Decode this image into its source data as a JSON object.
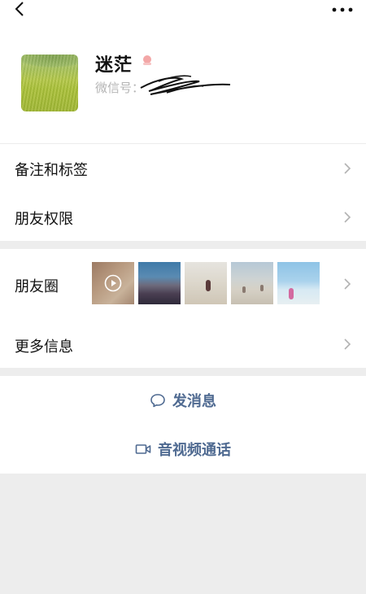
{
  "profile": {
    "nickname": "迷茫",
    "wechat_id_label": "微信号："
  },
  "icons": {
    "back": "chevron-left-icon",
    "more": "more-dots-icon",
    "gender": "female-gender-icon",
    "chevron": "chevron-right-icon",
    "play": "play-icon",
    "message": "chat-bubble-icon",
    "video": "video-camera-icon"
  },
  "rows": {
    "remark_label": "备注和标签",
    "permission_label": "朋友权限",
    "moments_label": "朋友圈",
    "more_info_label": "更多信息"
  },
  "actions": {
    "message_label": "发消息",
    "call_label": "音视频通话"
  },
  "colors": {
    "action_text": "#4f6a91",
    "background": "#ededed",
    "gender_icon": "#f3a7a7"
  }
}
